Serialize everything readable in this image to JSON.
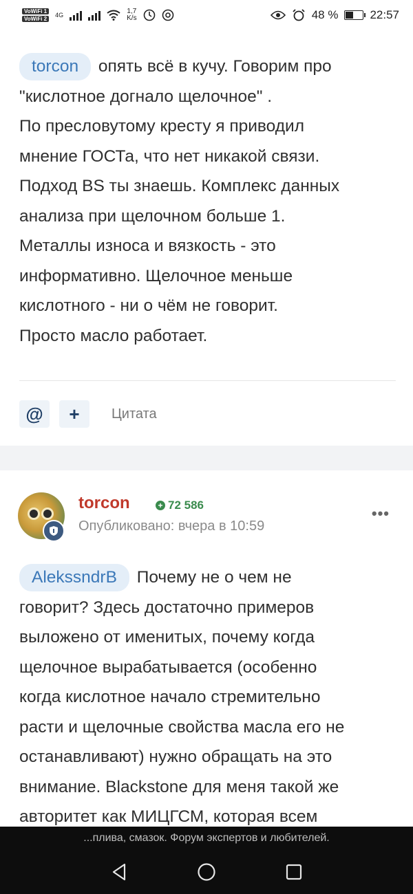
{
  "status_bar": {
    "sim1": "VoWiFi 1",
    "sim2": "VoWiFi 2",
    "network": "4G",
    "speed_value": "1,7",
    "speed_unit": "K/s",
    "battery": "48 %",
    "battery_level": 0.48,
    "time": "22:57"
  },
  "post1": {
    "mention": "torcon",
    "lines_after_mention": " опять всё в кучу. Говорим про",
    "lines": [
      "\"кислотное догнало щелочное\" .",
      "По пресловутому кресту я приводил",
      "мнение ГОСТа, что нет никакой связи.",
      "Подход BS ты знаешь. Комплекс данных",
      "анализа при щелочном больше 1.",
      "Металлы износа и вязкость - это",
      "информативно. Щелочное меньше",
      "кислотного - ни о чём не говорит.",
      "Просто масло работает."
    ]
  },
  "actions": {
    "mention_icon": "@",
    "add_icon": "+",
    "quote_label": "Цитата"
  },
  "author": {
    "name": "torcon",
    "reputation": "72 586",
    "published": "Опубликовано: вчера в 10:59",
    "more_icon": "•••"
  },
  "post2": {
    "mention": "AlekssndrB",
    "lines_after_mention": " Почему не о чем не",
    "lines": [
      "говорит? Здесь достаточно примеров",
      "выложено от именитых, почему когда",
      "щелочное вырабатывается (особенно",
      "когда кислотное начало стремительно",
      "расти и щелочные свойства масла его не",
      "останавливают) нужно обращать на это",
      "внимание. Blackstone для меня такой же",
      "авторитет как МИЦГСМ, которая всем"
    ]
  },
  "bottom": {
    "url_text": "...плива, смазок. Форум экспертов и любителей."
  }
}
